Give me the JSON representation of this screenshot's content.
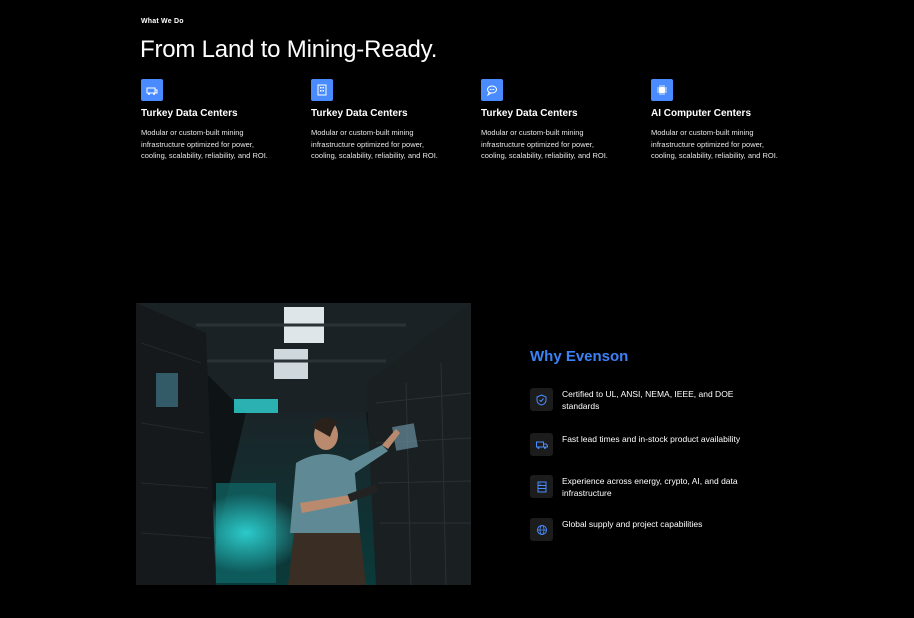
{
  "section": {
    "eyebrow": "What We Do",
    "headline": "From Land to Mining-Ready."
  },
  "features": [
    {
      "icon": "container-icon",
      "title": "Turkey Data Centers",
      "description": "Modular or custom-built mining infrastructure optimized for power, cooling, scalability, reliability, and ROI."
    },
    {
      "icon": "building-icon",
      "title": "Turkey Data Centers",
      "description": "Modular or custom-built mining infrastructure optimized for power, cooling, scalability, reliability, and ROI."
    },
    {
      "icon": "chat-bubble-icon",
      "title": "Turkey Data Centers",
      "description": "Modular or custom-built mining infrastructure optimized for power, cooling, scalability, reliability, and ROI."
    },
    {
      "icon": "chip-icon",
      "title": "AI Computer Centers",
      "description": "Modular or custom-built mining infrastructure optimized for power, cooling, scalability, reliability, and ROI."
    }
  ],
  "why": {
    "title": "Why Evenson",
    "items": [
      {
        "icon": "shield-check-icon",
        "text": "Certified to UL, ANSI, NEMA, IEEE, and DOE standards"
      },
      {
        "icon": "truck-icon",
        "text": "Fast lead times and in-stock product availability"
      },
      {
        "icon": "server-icon",
        "text": "Experience across energy, crypto, AI, and data infrastructure"
      },
      {
        "icon": "globe-icon",
        "text": "Global supply and project capabilities"
      }
    ]
  },
  "colors": {
    "background": "#000000",
    "accent": "#3b82f6",
    "icon_tile": "#4a8cff"
  }
}
